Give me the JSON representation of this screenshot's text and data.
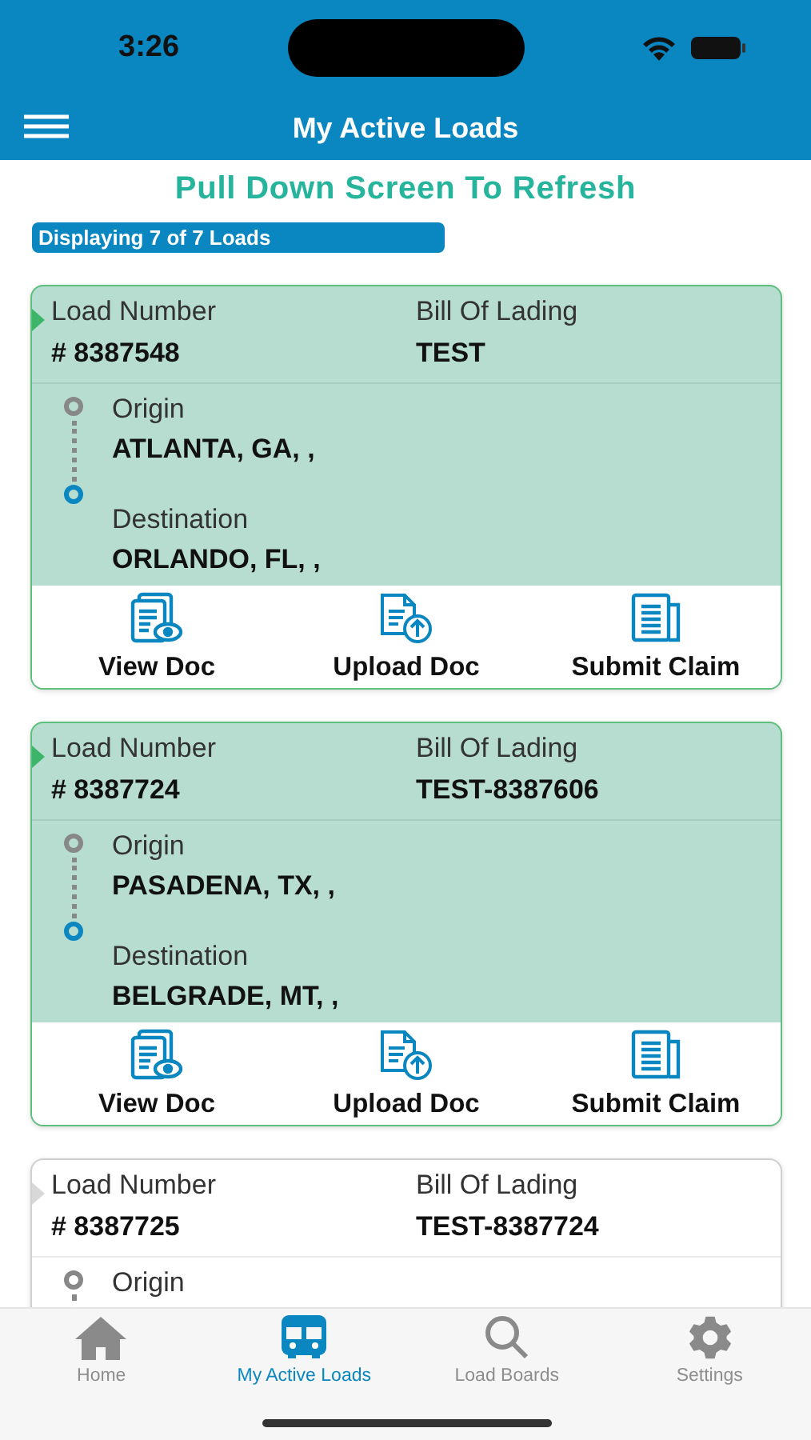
{
  "status_bar": {
    "time": "3:26"
  },
  "header": {
    "title": "My Active Loads"
  },
  "refresh_hint": "Pull Down Screen To Refresh",
  "count_badge": "Displaying 7 of 7 Loads",
  "loads": [
    {
      "selected": true,
      "load_label": "Load Number",
      "load_number": "# 8387548",
      "bol_label": "Bill Of Lading",
      "bol": "TEST",
      "origin_label": "Origin",
      "origin": "ATLANTA, GA, ,",
      "destination_label": "Destination",
      "destination": "ORLANDO, FL, ,",
      "actions": [
        {
          "kind": "view",
          "label": "View Doc"
        },
        {
          "kind": "upload",
          "label": "Upload Doc"
        },
        {
          "kind": "claim",
          "label": "Submit Claim"
        }
      ]
    },
    {
      "selected": true,
      "load_label": "Load Number",
      "load_number": "# 8387724",
      "bol_label": "Bill Of Lading",
      "bol": "TEST-8387606",
      "origin_label": "Origin",
      "origin": "PASADENA, TX, ,",
      "destination_label": "Destination",
      "destination": "BELGRADE, MT, ,",
      "actions": [
        {
          "kind": "view",
          "label": "View Doc"
        },
        {
          "kind": "upload",
          "label": "Upload Doc"
        },
        {
          "kind": "claim",
          "label": "Submit Claim"
        }
      ]
    },
    {
      "selected": false,
      "load_label": "Load Number",
      "load_number": "# 8387725",
      "bol_label": "Bill Of Lading",
      "bol": "TEST-8387724",
      "origin_label": "Origin"
    }
  ],
  "tabs": [
    {
      "kind": "home",
      "label": "Home",
      "selected": false
    },
    {
      "kind": "bus",
      "label": "My Active Loads",
      "selected": true
    },
    {
      "kind": "search",
      "label": "Load Boards",
      "selected": false
    },
    {
      "kind": "settings",
      "label": "Settings",
      "selected": false
    }
  ]
}
